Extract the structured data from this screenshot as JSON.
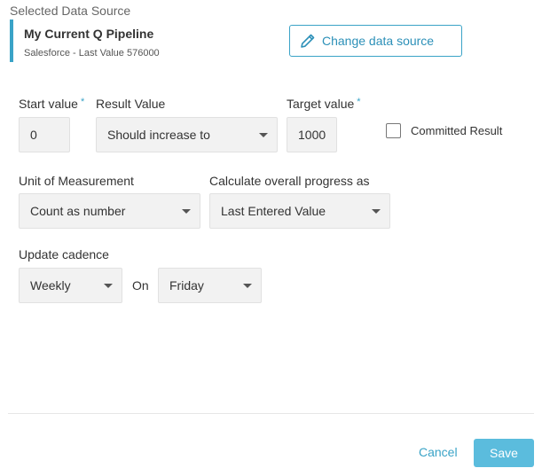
{
  "data_source": {
    "section_label": "Selected Data Source",
    "name": "My Current Q Pipeline",
    "subtitle": "Salesforce - Last Value 576000",
    "change_button_label": "Change data source",
    "accent_color": "#3aa3c7"
  },
  "form": {
    "start_value": {
      "label": "Start value",
      "required_mark": "*",
      "value": "0"
    },
    "result_value": {
      "label": "Result Value",
      "selected": "Should increase to"
    },
    "target_value": {
      "label": "Target value",
      "required_mark": "*",
      "value": "1000"
    },
    "committed_result": {
      "label": "Committed Result",
      "checked": false
    },
    "unit_of_measurement": {
      "label": "Unit of Measurement",
      "selected": "Count as number"
    },
    "overall_progress": {
      "label": "Calculate overall progress as",
      "selected": "Last Entered Value"
    },
    "update_cadence": {
      "label": "Update cadence",
      "selected": "Weekly",
      "on_label": "On",
      "day_selected": "Friday"
    }
  },
  "footer": {
    "cancel_label": "Cancel",
    "save_label": "Save",
    "save_color": "#5bbcdd"
  },
  "icons": {
    "change_source": "pencil-icon",
    "dropdown": "caret-down-icon"
  }
}
